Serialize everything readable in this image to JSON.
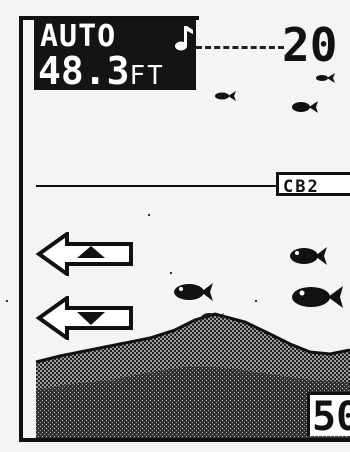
{
  "status": {
    "mode": "AUTO",
    "depth_value": "48.3",
    "depth_unit": "FT",
    "mode_icon": "fish-alarm-note-icon"
  },
  "scale": {
    "top": "20",
    "bottom": "50"
  },
  "zoom": {
    "label": "CB2"
  },
  "buttons": {
    "up_icon": "arrow-up-icon",
    "down_icon": "arrow-down-icon"
  },
  "fish_icons": [
    "fish-icon",
    "fish-icon",
    "fish-icon",
    "fish-icon",
    "fish-icon",
    "fish-icon",
    "fish-icon"
  ],
  "colors": {
    "ink": "#111111",
    "background": "#f4f4f2",
    "bottom_fill": "#6a6a6a"
  }
}
